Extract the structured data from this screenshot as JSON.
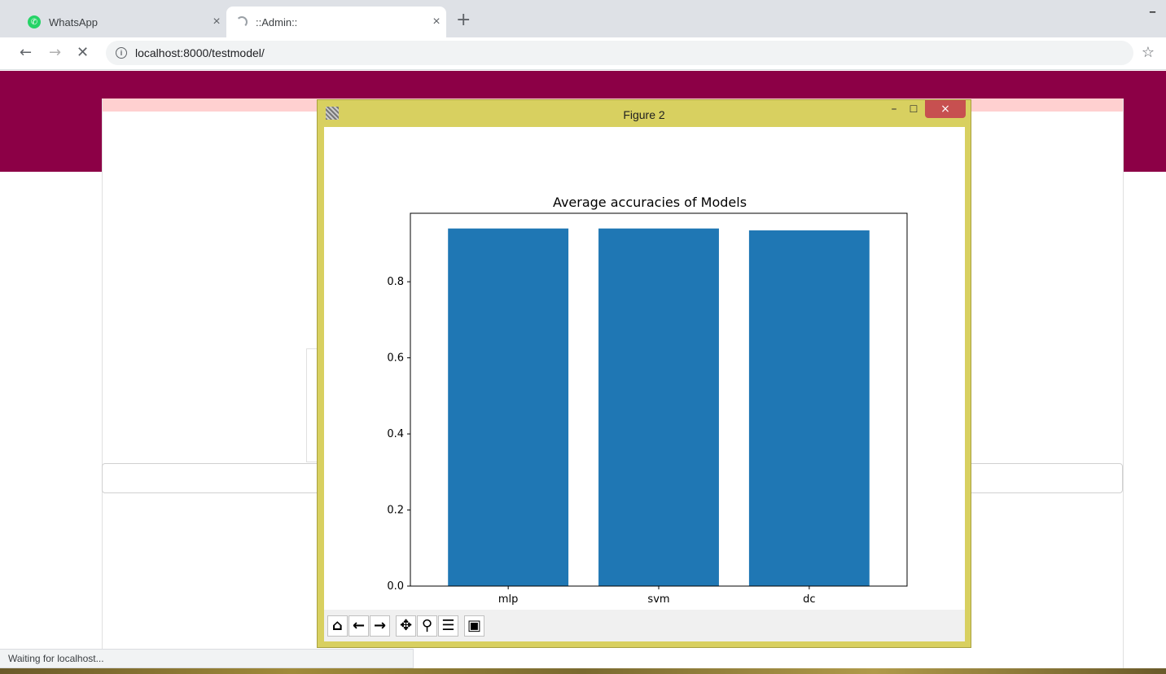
{
  "browser": {
    "tabs": [
      {
        "label": "WhatsApp",
        "icon": "whatsapp-icon"
      },
      {
        "label": "::Admin::",
        "icon": "loading-spinner-icon"
      }
    ],
    "address": "localhost:8000/testmodel/",
    "status_text": "Waiting for localhost..."
  },
  "page": {
    "banner_color": "#8c0046"
  },
  "figure_window": {
    "title": "Figure 2",
    "toolbar": [
      "home-icon",
      "back-icon",
      "forward-icon",
      "pan-icon",
      "zoom-icon",
      "configure-subplots-icon",
      "save-icon"
    ]
  },
  "chart_data": {
    "type": "bar",
    "title": "Average accuracies of Models",
    "categories": [
      "mlp",
      "svm",
      "dc"
    ],
    "values": [
      0.94,
      0.94,
      0.935
    ],
    "ylim": [
      0,
      0.98
    ],
    "yticks": [
      "0.0",
      "0.2",
      "0.4",
      "0.6",
      "0.8"
    ],
    "xlabel": "",
    "ylabel": "",
    "bar_color": "#1f77b4",
    "grid": false
  }
}
